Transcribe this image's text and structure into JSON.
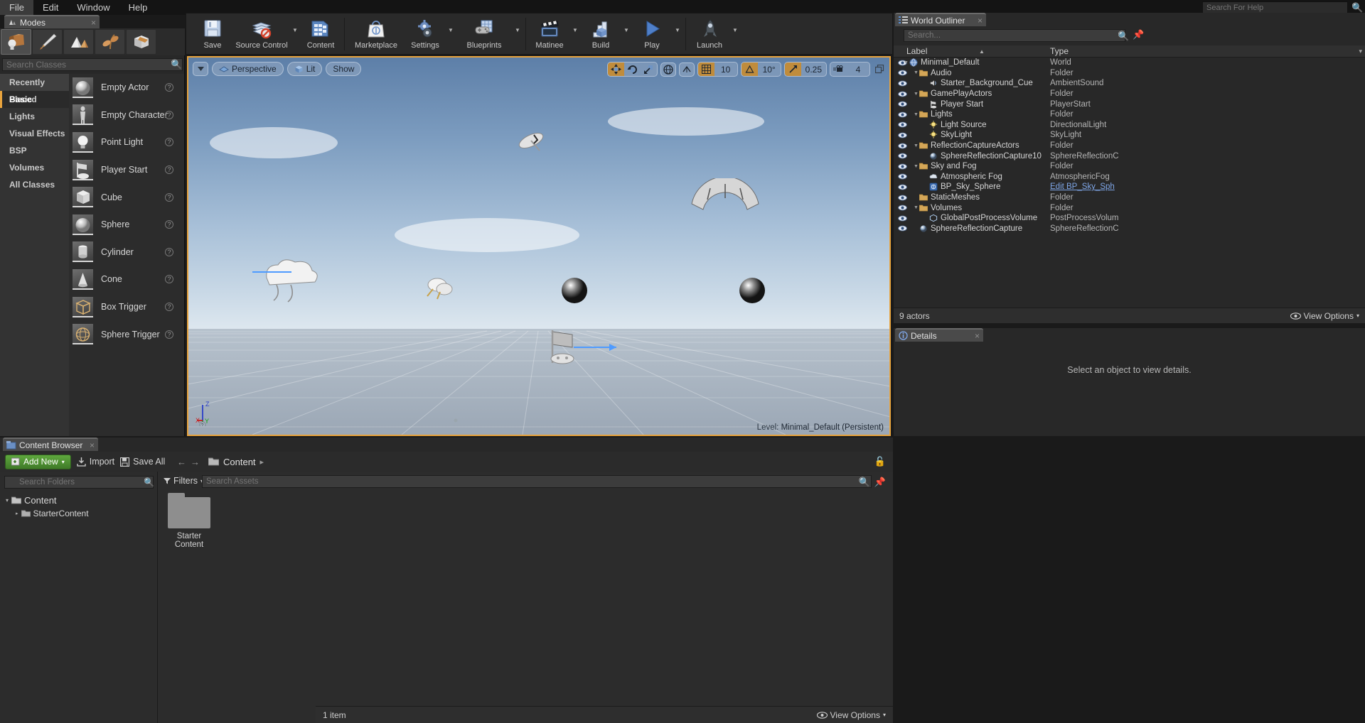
{
  "menubar": {
    "items": [
      "File",
      "Edit",
      "Window",
      "Help"
    ],
    "search_placeholder": "Search For Help"
  },
  "modes": {
    "tab_label": "Modes",
    "close": "×",
    "buttons": [
      {
        "name": "place-mode",
        "selected": true
      },
      {
        "name": "paint-mode",
        "selected": false
      },
      {
        "name": "landscape-mode",
        "selected": false
      },
      {
        "name": "foliage-mode",
        "selected": false
      },
      {
        "name": "geometry-editing-mode",
        "selected": false
      }
    ]
  },
  "place": {
    "search_placeholder": "Search Classes",
    "categories": [
      {
        "label": "Recently Placed",
        "selected": false
      },
      {
        "label": "Basic",
        "selected": true
      },
      {
        "label": "Lights",
        "selected": false
      },
      {
        "label": "Visual Effects",
        "selected": false
      },
      {
        "label": "BSP",
        "selected": false
      },
      {
        "label": "Volumes",
        "selected": false
      },
      {
        "label": "All Classes",
        "selected": false
      }
    ],
    "assets": [
      {
        "label": "Empty Actor",
        "icon": "sphere-thumb"
      },
      {
        "label": "Empty Character",
        "icon": "character-thumb"
      },
      {
        "label": "Point Light",
        "icon": "bulb-thumb"
      },
      {
        "label": "Player Start",
        "icon": "playerstart-thumb"
      },
      {
        "label": "Cube",
        "icon": "cube-thumb"
      },
      {
        "label": "Sphere",
        "icon": "sphere-thumb"
      },
      {
        "label": "Cylinder",
        "icon": "cylinder-thumb"
      },
      {
        "label": "Cone",
        "icon": "cone-thumb"
      },
      {
        "label": "Box Trigger",
        "icon": "boxtrigger-thumb"
      },
      {
        "label": "Sphere Trigger",
        "icon": "spheretrigger-thumb"
      }
    ],
    "help_glyph": "?"
  },
  "toolbar": {
    "buttons": [
      {
        "label": "Save",
        "icon": "save-icon",
        "caret": false
      },
      {
        "label": "Source Control",
        "icon": "source-control-icon",
        "caret": true
      },
      {
        "label": "Content",
        "icon": "content-icon",
        "caret": false
      },
      {
        "label": "Marketplace",
        "icon": "marketplace-icon",
        "caret": false
      },
      {
        "label": "Settings",
        "icon": "settings-icon",
        "caret": true
      },
      {
        "label": "Blueprints",
        "icon": "blueprints-icon",
        "caret": true
      },
      {
        "label": "Matinee",
        "icon": "matinee-icon",
        "caret": true
      },
      {
        "label": "Build",
        "icon": "build-icon",
        "caret": true
      },
      {
        "label": "Play",
        "icon": "play-icon",
        "caret": true
      },
      {
        "label": "Launch",
        "icon": "launch-icon",
        "caret": true
      }
    ]
  },
  "viewport": {
    "left_buttons": [
      {
        "label": "",
        "icon": "viewport-options-caret",
        "name": "viewport-options"
      },
      {
        "label": "Perspective",
        "icon": "perspective-icon",
        "name": "camera-mode"
      },
      {
        "label": "Lit",
        "icon": "lit-icon",
        "name": "view-mode"
      },
      {
        "label": "Show",
        "icon": "",
        "name": "show-menu"
      }
    ],
    "gizmos": [
      {
        "name": "translate-gizmo",
        "active": true
      },
      {
        "name": "rotate-gizmo",
        "active": false
      },
      {
        "name": "scale-gizmo",
        "active": false
      }
    ],
    "coord_system": {
      "name": "world-coordinate-toggle",
      "active": false
    },
    "surface_snap": {
      "name": "surface-snap-toggle",
      "active": false
    },
    "grid_snap": {
      "name": "grid-snap",
      "active": true,
      "value": "10"
    },
    "angle_snap": {
      "name": "angle-snap",
      "active": true,
      "value": "10°"
    },
    "scale_snap": {
      "name": "scale-snap",
      "active": true,
      "value": "0.25"
    },
    "camera_speed": {
      "name": "camera-speed",
      "value": "4"
    },
    "maximize": {
      "name": "maximize-viewport"
    },
    "level_prefix": "Level:",
    "level_name": "Minimal_Default (Persistent)",
    "axis": {
      "x": "X",
      "y": "Y",
      "z": "Z"
    }
  },
  "outliner": {
    "tab_label": "World Outliner",
    "close": "×",
    "search_placeholder": "Search...",
    "col_label": "Label",
    "col_type": "Type",
    "rows": [
      {
        "label": "Minimal_Default",
        "type": "World",
        "depth": 0,
        "icon": "world-icon",
        "expandable": true
      },
      {
        "label": "Audio",
        "type": "Folder",
        "depth": 1,
        "icon": "folder-icon",
        "expandable": true
      },
      {
        "label": "Starter_Background_Cue",
        "type": "AmbientSound",
        "depth": 2,
        "icon": "sound-icon",
        "expandable": false
      },
      {
        "label": "GamePlayActors",
        "type": "Folder",
        "depth": 1,
        "icon": "folder-icon",
        "expandable": true
      },
      {
        "label": "Player Start",
        "type": "PlayerStart",
        "depth": 2,
        "icon": "playerstart-icon",
        "expandable": false
      },
      {
        "label": "Lights",
        "type": "Folder",
        "depth": 1,
        "icon": "folder-icon",
        "expandable": true
      },
      {
        "label": "Light Source",
        "type": "DirectionalLight",
        "depth": 2,
        "icon": "light-icon",
        "expandable": false
      },
      {
        "label": "SkyLight",
        "type": "SkyLight",
        "depth": 2,
        "icon": "light-icon",
        "expandable": false
      },
      {
        "label": "ReflectionCaptureActors",
        "type": "Folder",
        "depth": 1,
        "icon": "folder-icon",
        "expandable": true
      },
      {
        "label": "SphereReflectionCapture10",
        "type": "SphereReflectionC",
        "depth": 2,
        "icon": "reflection-icon",
        "expandable": false
      },
      {
        "label": "Sky and Fog",
        "type": "Folder",
        "depth": 1,
        "icon": "folder-icon",
        "expandable": true
      },
      {
        "label": "Atmospheric Fog",
        "type": "AtmosphericFog",
        "depth": 2,
        "icon": "fog-icon",
        "expandable": false
      },
      {
        "label": "BP_Sky_Sphere",
        "type": "Edit BP_Sky_Sph",
        "depth": 2,
        "icon": "blueprint-icon",
        "expandable": false,
        "type_is_link": true
      },
      {
        "label": "StaticMeshes",
        "type": "Folder",
        "depth": 1,
        "icon": "folder-icon",
        "expandable": false
      },
      {
        "label": "Volumes",
        "type": "Folder",
        "depth": 1,
        "icon": "folder-icon",
        "expandable": true
      },
      {
        "label": "GlobalPostProcessVolume",
        "type": "PostProcessVolum",
        "depth": 2,
        "icon": "volume-icon",
        "expandable": false
      },
      {
        "label": "SphereReflectionCapture",
        "type": "SphereReflectionC",
        "depth": 1,
        "icon": "reflection-icon",
        "expandable": false
      }
    ],
    "actor_count": "9 actors",
    "view_options": "View Options"
  },
  "details": {
    "tab_label": "Details",
    "close": "×",
    "empty_message": "Select an object to view details."
  },
  "content_browser": {
    "tab_label": "Content Browser",
    "close": "×",
    "add_new": "Add New",
    "import": "Import",
    "save_all": "Save All",
    "breadcrumb": "Content",
    "folder_search_placeholder": "Search Folders",
    "tree": [
      {
        "label": "Content",
        "depth": 0
      },
      {
        "label": "StarterContent",
        "depth": 1
      }
    ],
    "filters": "Filters",
    "asset_search_placeholder": "Search Assets",
    "assets": [
      {
        "name_line1": "Starter",
        "name_line2": "Content",
        "type": "folder"
      }
    ],
    "item_count": "1 item",
    "view_options": "View Options"
  },
  "colors": {
    "accent_orange": "#e8a33d",
    "green_button": "#5fa83e",
    "panel_bg": "#282828",
    "link_blue": "#7fa7e8"
  }
}
